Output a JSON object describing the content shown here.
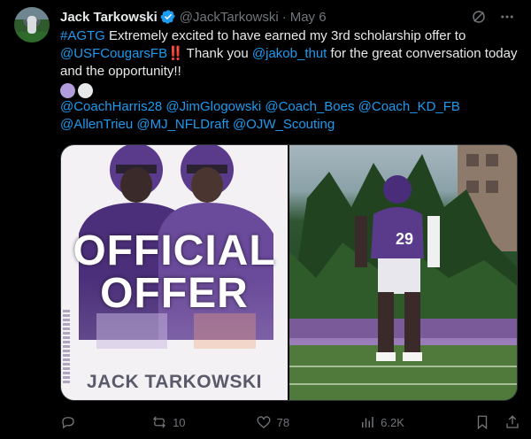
{
  "author": {
    "name": "Jack Tarkowski",
    "handle": "@JackTarkowski",
    "separator": "·",
    "date": "May 6"
  },
  "body": {
    "line1_hashtag": "#AGTG",
    "line1_text": " Extremely excited to have earned my 3rd scholarship offer to",
    "mention_usf": "@USFCougarsFB",
    "emphasis": "‼️",
    "after_usf": " Thank you ",
    "mention_jakob": "@jakob_thut",
    "after_jakob": " for the great conversation today and the opportunity!!",
    "mentions_line1": "@CoachHarris28 @JimGlogowski @Coach_Boes @Coach_KD_FB",
    "mentions_line2": "@AllenTrieu @MJ_NFLDraft @OJW_Scouting"
  },
  "emoji_hearts": [
    {
      "icon": "purple-heart-icon",
      "color": "#b29ddc"
    },
    {
      "icon": "white-heart-icon",
      "color": "#e7e9ea"
    }
  ],
  "media": {
    "graphic_line1": "OFFICIAL",
    "graphic_line2": "OFFER",
    "graphic_name": "JACK TARKOWSKI",
    "jersey_number": "29"
  },
  "actions": {
    "reply_count": "",
    "retweet_count": "10",
    "like_count": "78",
    "views_count": "6.2K"
  },
  "colors": {
    "link": "#1d9bf0",
    "muted": "#71767b",
    "text": "#e7e9ea",
    "verified": "#1d9bf0",
    "team_purple": "#5a3a8a"
  }
}
